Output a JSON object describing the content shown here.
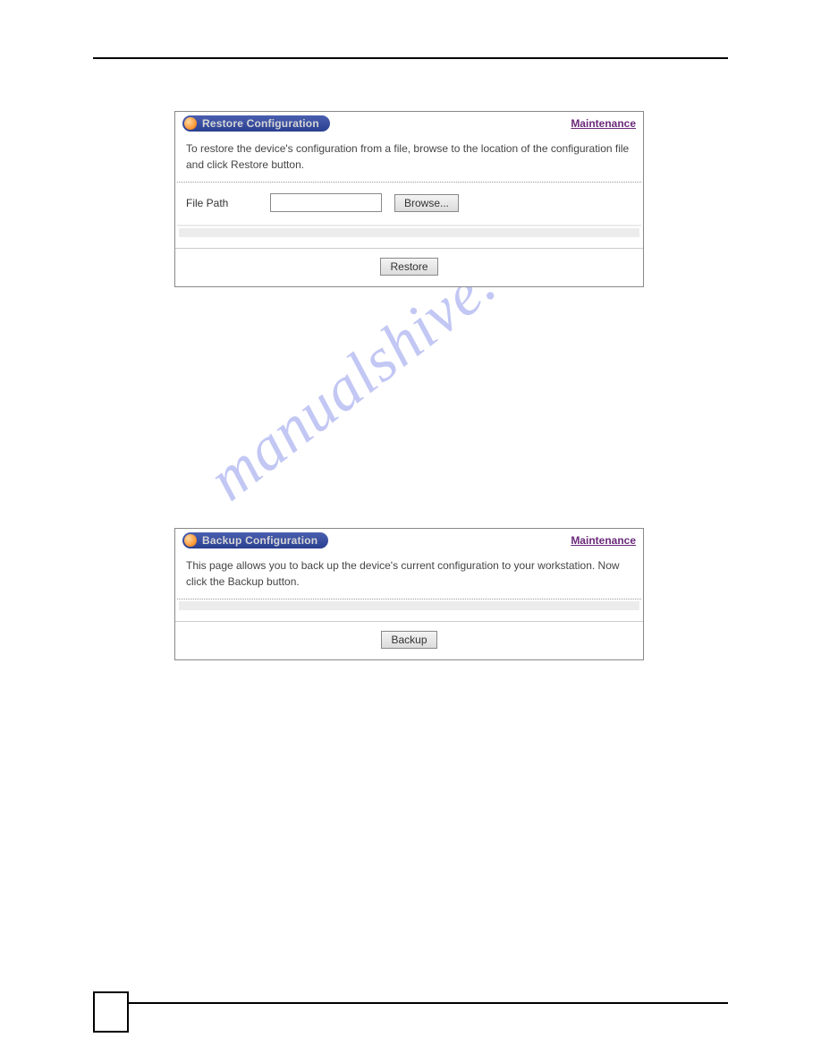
{
  "watermark": "manualshive.com",
  "panel1": {
    "title": "Restore Configuration",
    "link": "Maintenance",
    "description": "To restore the device's configuration from a file, browse to the location of the configuration file and click Restore button.",
    "filePathLabel": "File Path",
    "browseButton": "Browse...",
    "restoreButton": "Restore"
  },
  "panel2": {
    "title": "Backup Configuration",
    "link": "Maintenance",
    "description": "This page allows you to back up the device's current configuration to your workstation. Now click the Backup button.",
    "backupButton": "Backup"
  }
}
